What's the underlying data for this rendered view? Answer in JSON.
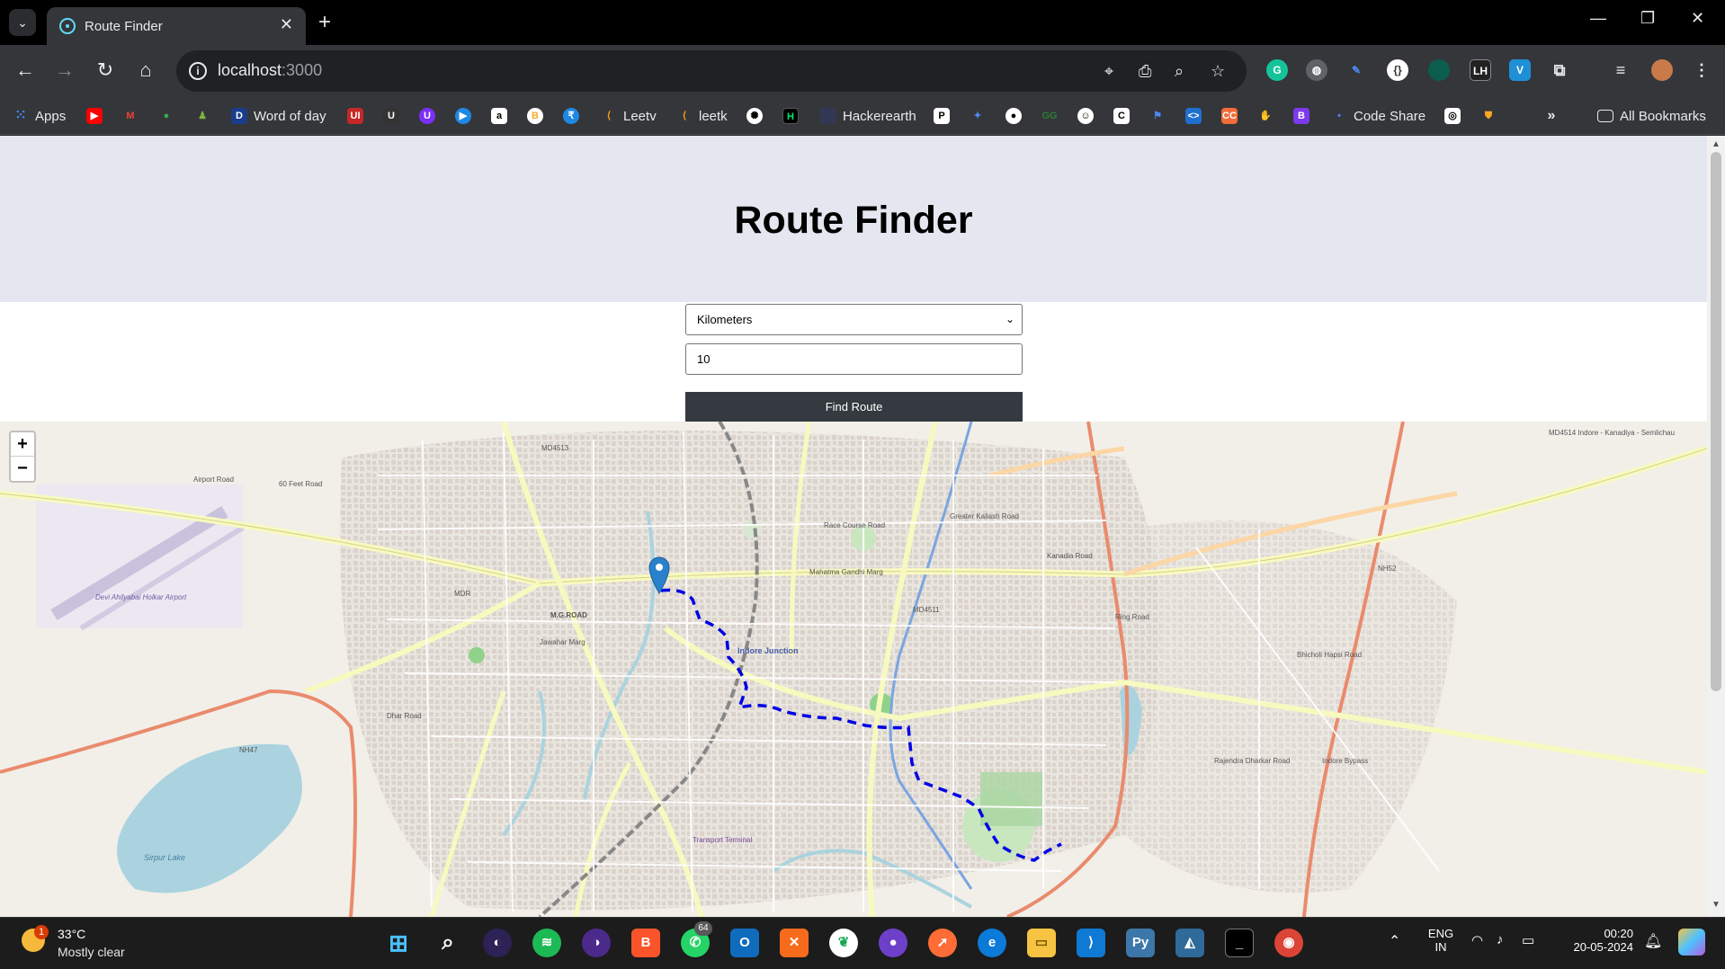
{
  "browser": {
    "tab_title": "Route Finder",
    "url_host": "localhost",
    "url_port": ":3000"
  },
  "bookmarks": [
    {
      "label": "Apps",
      "color": "#4285f4"
    },
    {
      "label": "Word of day",
      "color": "#1a3e8c"
    },
    {
      "label": "Leetv",
      "color": "#ffa116"
    },
    {
      "label": "leetk",
      "color": "#ffa116"
    },
    {
      "label": "Hackerearth",
      "color": "#323754"
    },
    {
      "label": "Code Share",
      "color": "#5b7cfa"
    },
    {
      "label": "All Bookmarks",
      "color": "#e8eaed"
    }
  ],
  "page": {
    "title": "Route Finder",
    "unit_select": {
      "value": "Kilometers"
    },
    "distance_input": {
      "value": "10"
    },
    "find_button": "Find Route"
  },
  "map": {
    "zoom_in": "+",
    "zoom_out": "−",
    "labels": {
      "airport": "Devi Ahilyabai Holkar Airport",
      "junction": "Indore Junction",
      "lake": "Sirpur Lake",
      "lake2": "Sirpur Lake",
      "md4513": "MD4513",
      "md4511": "MD4511",
      "md4514": "MD4514 Indore - Kanadiya - Semlichau",
      "nh52": "NH52",
      "nh47": "NH47",
      "mdr": "MDR",
      "mgroad": "M.G.ROAD",
      "airport_road": "Airport Road",
      "feet60": "60 Feet Road",
      "jawahar": "Jawahar Marg",
      "racecourse": "Race Course Road",
      "kailash": "Greater Kailash Road",
      "kanadia": "Kanadia Road",
      "bhicholi": "Bhicholi Hapsi Road",
      "ring": "Ring Road",
      "bypass": "Indore Bypass",
      "rajendra": "Rajendra Dharkar Road",
      "transport": "Transport Terminal",
      "dhar": "Dhar Road",
      "mahatma": "Mahatma Gandhi Marg"
    },
    "route_color": "#0000e6"
  },
  "taskbar": {
    "temperature": "33°C",
    "condition": "Mostly clear",
    "weather_badge": "1",
    "whatsapp_badge": "64",
    "language": "ENG",
    "region": "IN",
    "time": "00:20",
    "date": "20-05-2024"
  }
}
